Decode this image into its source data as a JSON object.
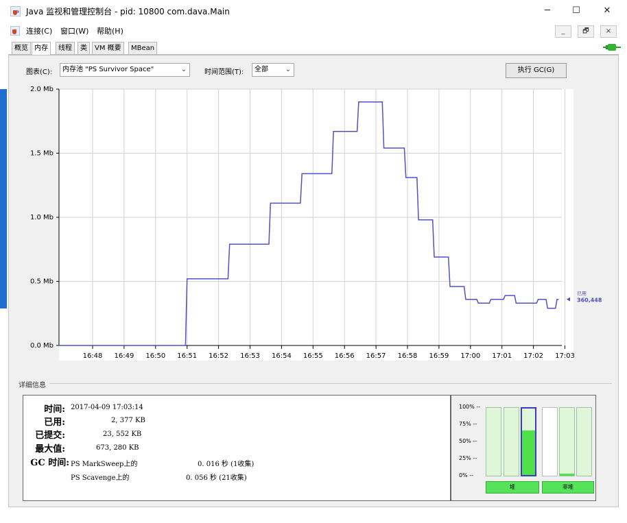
{
  "window": {
    "title": "Java 监视和管理控制台 - pid: 10800 com.dava.Main",
    "minimize": "─",
    "maximize": "☐",
    "close": "✕"
  },
  "menu": {
    "items": [
      "连接(C)",
      "窗口(W)",
      "帮助(H)"
    ],
    "mdi_min": "_",
    "mdi_restore": "🗗",
    "mdi_close": "×"
  },
  "tabs": [
    "概览",
    "内存",
    "线程",
    "类",
    "VM 概要",
    "MBean"
  ],
  "active_tab": "内存",
  "controls": {
    "chart_label": "图表(C):",
    "chart_value": "内存池 \"PS Survivor Space\"",
    "time_label": "时间范围(T):",
    "time_value": "全部",
    "gc_button": "执行 GC(G)"
  },
  "chart_data": {
    "type": "line",
    "y_ticks": [
      "2.0 Mb",
      "1.5 Mb",
      "1.0 Mb",
      "0.5 Mb",
      "0.0 Mb"
    ],
    "ylim": [
      0,
      2.0
    ],
    "x_ticks": [
      "16:48",
      "16:49",
      "16:50",
      "16:51",
      "16:52",
      "16:53",
      "16:54",
      "16:55",
      "16:56",
      "16:57",
      "16:58",
      "16:59",
      "17:00",
      "17:01",
      "17:02",
      "17:03"
    ],
    "line_color": "#5050c8",
    "series": [
      {
        "name": "已用",
        "current": "360,448",
        "points": [
          [
            0.0,
            0
          ],
          [
            2.95,
            0
          ],
          [
            3.0,
            0.52
          ],
          [
            4.3,
            0.52
          ],
          [
            4.35,
            0.79
          ],
          [
            5.6,
            0.79
          ],
          [
            5.65,
            1.11
          ],
          [
            6.6,
            1.11
          ],
          [
            6.65,
            1.34
          ],
          [
            7.6,
            1.34
          ],
          [
            7.65,
            1.67
          ],
          [
            8.4,
            1.67
          ],
          [
            8.45,
            1.9
          ],
          [
            9.2,
            1.9
          ],
          [
            9.25,
            1.54
          ],
          [
            9.9,
            1.54
          ],
          [
            9.95,
            1.31
          ],
          [
            10.3,
            1.31
          ],
          [
            10.35,
            0.98
          ],
          [
            10.8,
            0.98
          ],
          [
            10.85,
            0.69
          ],
          [
            11.3,
            0.69
          ],
          [
            11.35,
            0.46
          ],
          [
            11.8,
            0.46
          ],
          [
            11.85,
            0.36
          ],
          [
            12.2,
            0.36
          ],
          [
            12.25,
            0.33
          ],
          [
            12.6,
            0.33
          ],
          [
            12.65,
            0.36
          ],
          [
            13.05,
            0.36
          ],
          [
            13.1,
            0.39
          ],
          [
            13.4,
            0.39
          ],
          [
            13.45,
            0.33
          ],
          [
            14.1,
            0.33
          ],
          [
            14.15,
            0.36
          ],
          [
            14.4,
            0.36
          ],
          [
            14.45,
            0.29
          ],
          [
            14.7,
            0.29
          ],
          [
            14.75,
            0.36
          ],
          [
            14.8,
            0.36
          ]
        ]
      }
    ]
  },
  "details": {
    "title": "详细信息",
    "rows": [
      {
        "label": "时间:",
        "value": "2017-04-09 17:03:14"
      },
      {
        "label": "已用:",
        "value": "2, 377 KB"
      },
      {
        "label": "已提交:",
        "value": "23, 552 KB"
      },
      {
        "label": "最大值:",
        "value": "673, 280 KB"
      }
    ],
    "gc_label": "GC 时间:",
    "gc_rows": [
      {
        "name": "PS MarkSweep上的",
        "value": "0. 016 秒 (1收集)"
      },
      {
        "name": "PS Scavenge上的",
        "value": "0. 056 秒 (21收集)"
      }
    ]
  },
  "pools": {
    "pct_labels": [
      "100% --",
      "75% --",
      "50% --",
      "25% --",
      "0% --"
    ],
    "heap_label": "堆",
    "nonheap_label": "非堆",
    "bar_fills": [
      0.0,
      0.0,
      0.67,
      0.0,
      0.03,
      0.0
    ],
    "selected_index": 2
  }
}
